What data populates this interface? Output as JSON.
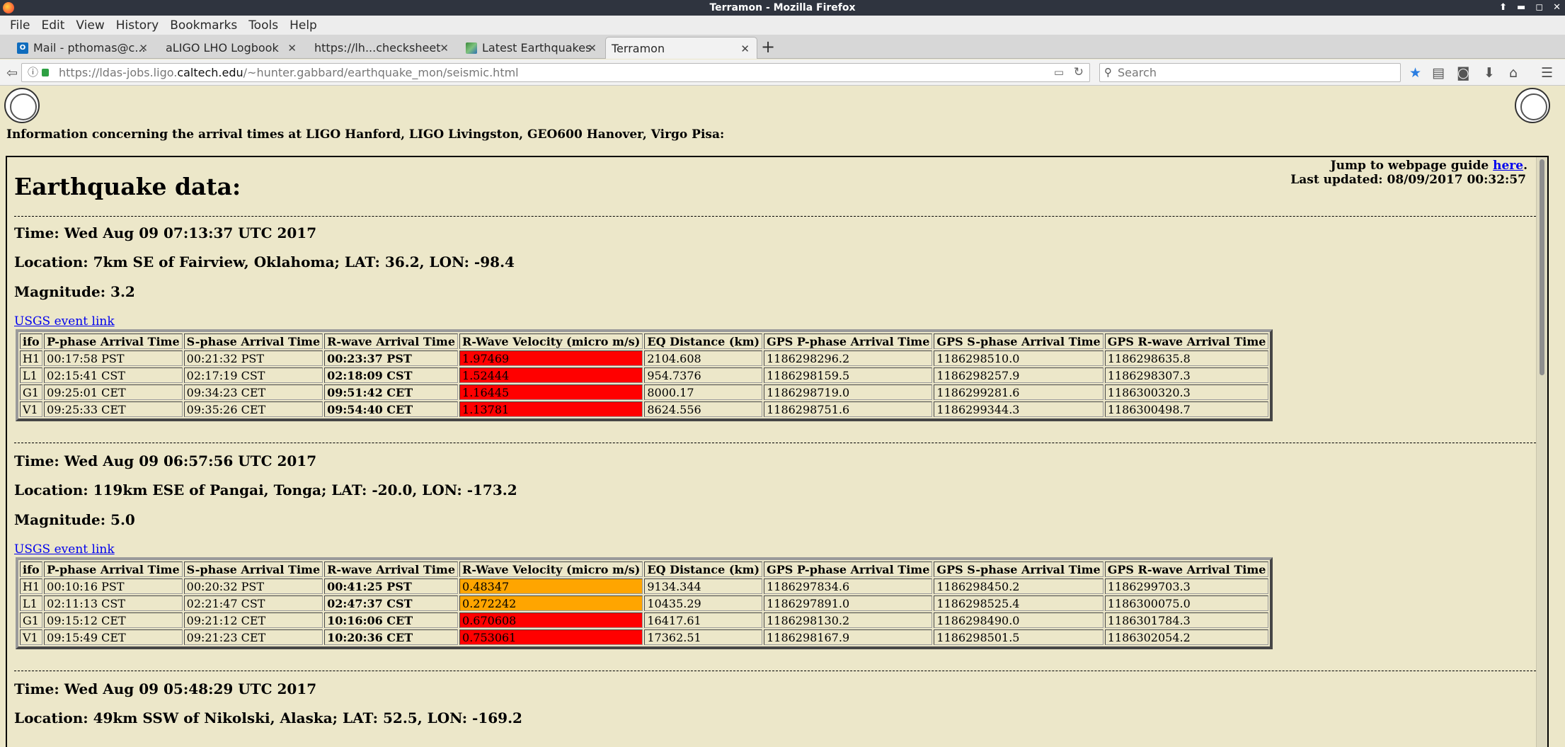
{
  "window": {
    "title": "Terramon - Mozilla Firefox"
  },
  "menu": [
    "File",
    "Edit",
    "View",
    "History",
    "Bookmarks",
    "Tools",
    "Help"
  ],
  "tabs": [
    {
      "label": "Mail - pthomas@c...",
      "icon": "outlook-icon"
    },
    {
      "label": "aLIGO LHO Logbook",
      "icon": "none"
    },
    {
      "label": "https://lh...checksheet",
      "icon": "none"
    },
    {
      "label": "Latest Earthquakes",
      "icon": "earthquake-map-icon"
    },
    {
      "label": "Terramon",
      "icon": "none",
      "active": true
    }
  ],
  "url": {
    "prefix": "https://ldas-jobs.ligo.",
    "host": "caltech.edu",
    "path": "/~hunter.gabbard/earthquake_mon/seismic.html"
  },
  "search": {
    "placeholder": "Search"
  },
  "page": {
    "intro": "Information concerning the arrival times at LIGO Hanford, LIGO Livingston, GEO600 Hanover, Virgo Pisa:",
    "jump_text": "Jump to webpage guide ",
    "jump_link": "here",
    "jump_after": ".",
    "last_updated": "Last updated: 08/09/2017 00:32:57",
    "heading": "Earthquake data:",
    "usgs_link": "USGS event link",
    "columns": [
      "ifo",
      "P-phase Arrival Time",
      "S-phase Arrival Time",
      "R-wave Arrival Time",
      "R-Wave Velocity (micro m/s)",
      "EQ Distance (km)",
      "GPS P-phase Arrival Time",
      "GPS S-phase Arrival Time",
      "GPS R-wave Arrival Time"
    ],
    "events": [
      {
        "time": "Time: Wed Aug 09 07:13:37 UTC 2017",
        "location": "Location: 7km SE of Fairview, Oklahoma; LAT: 36.2, LON: -98.4",
        "magnitude": "Magnitude: 3.2",
        "rows": [
          {
            "ifo": "H1",
            "p": "00:17:58 PST",
            "s": "00:21:32 PST",
            "r": "00:23:37 PST",
            "vel": "1.97469",
            "vel_color": "#ff0000",
            "dist": "2104.608",
            "gps_p": "1186298296.2",
            "gps_s": "1186298510.0",
            "gps_r": "1186298635.8"
          },
          {
            "ifo": "L1",
            "p": "02:15:41 CST",
            "s": "02:17:19 CST",
            "r": "02:18:09 CST",
            "vel": "1.52444",
            "vel_color": "#ff0000",
            "dist": "954.7376",
            "gps_p": "1186298159.5",
            "gps_s": "1186298257.9",
            "gps_r": "1186298307.3"
          },
          {
            "ifo": "G1",
            "p": "09:25:01 CET",
            "s": "09:34:23 CET",
            "r": "09:51:42 CET",
            "vel": "1.16445",
            "vel_color": "#ff0000",
            "dist": "8000.17",
            "gps_p": "1186298719.0",
            "gps_s": "1186299281.6",
            "gps_r": "1186300320.3"
          },
          {
            "ifo": "V1",
            "p": "09:25:33 CET",
            "s": "09:35:26 CET",
            "r": "09:54:40 CET",
            "vel": "1.13781",
            "vel_color": "#ff0000",
            "dist": "8624.556",
            "gps_p": "1186298751.6",
            "gps_s": "1186299344.3",
            "gps_r": "1186300498.7"
          }
        ]
      },
      {
        "time": "Time: Wed Aug 09 06:57:56 UTC 2017",
        "location": "Location: 119km ESE of Pangai, Tonga; LAT: -20.0, LON: -173.2",
        "magnitude": "Magnitude: 5.0",
        "rows": [
          {
            "ifo": "H1",
            "p": "00:10:16 PST",
            "s": "00:20:32 PST",
            "r": "00:41:25 PST",
            "vel": "0.48347",
            "vel_color": "#ffa500",
            "dist": "9134.344",
            "gps_p": "1186297834.6",
            "gps_s": "1186298450.2",
            "gps_r": "1186299703.3"
          },
          {
            "ifo": "L1",
            "p": "02:11:13 CST",
            "s": "02:21:47 CST",
            "r": "02:47:37 CST",
            "vel": "0.272242",
            "vel_color": "#ffa500",
            "dist": "10435.29",
            "gps_p": "1186297891.0",
            "gps_s": "1186298525.4",
            "gps_r": "1186300075.0"
          },
          {
            "ifo": "G1",
            "p": "09:15:12 CET",
            "s": "09:21:12 CET",
            "r": "10:16:06 CET",
            "vel": "0.670608",
            "vel_color": "#ff0000",
            "dist": "16417.61",
            "gps_p": "1186298130.2",
            "gps_s": "1186298490.0",
            "gps_r": "1186301784.3"
          },
          {
            "ifo": "V1",
            "p": "09:15:49 CET",
            "s": "09:21:23 CET",
            "r": "10:20:36 CET",
            "vel": "0.753061",
            "vel_color": "#ff0000",
            "dist": "17362.51",
            "gps_p": "1186298167.9",
            "gps_s": "1186298501.5",
            "gps_r": "1186302054.2"
          }
        ]
      },
      {
        "time": "Time: Wed Aug 09 05:48:29 UTC 2017",
        "location": "Location: 49km SSW of Nikolski, Alaska; LAT: 52.5, LON: -169.2"
      }
    ]
  }
}
